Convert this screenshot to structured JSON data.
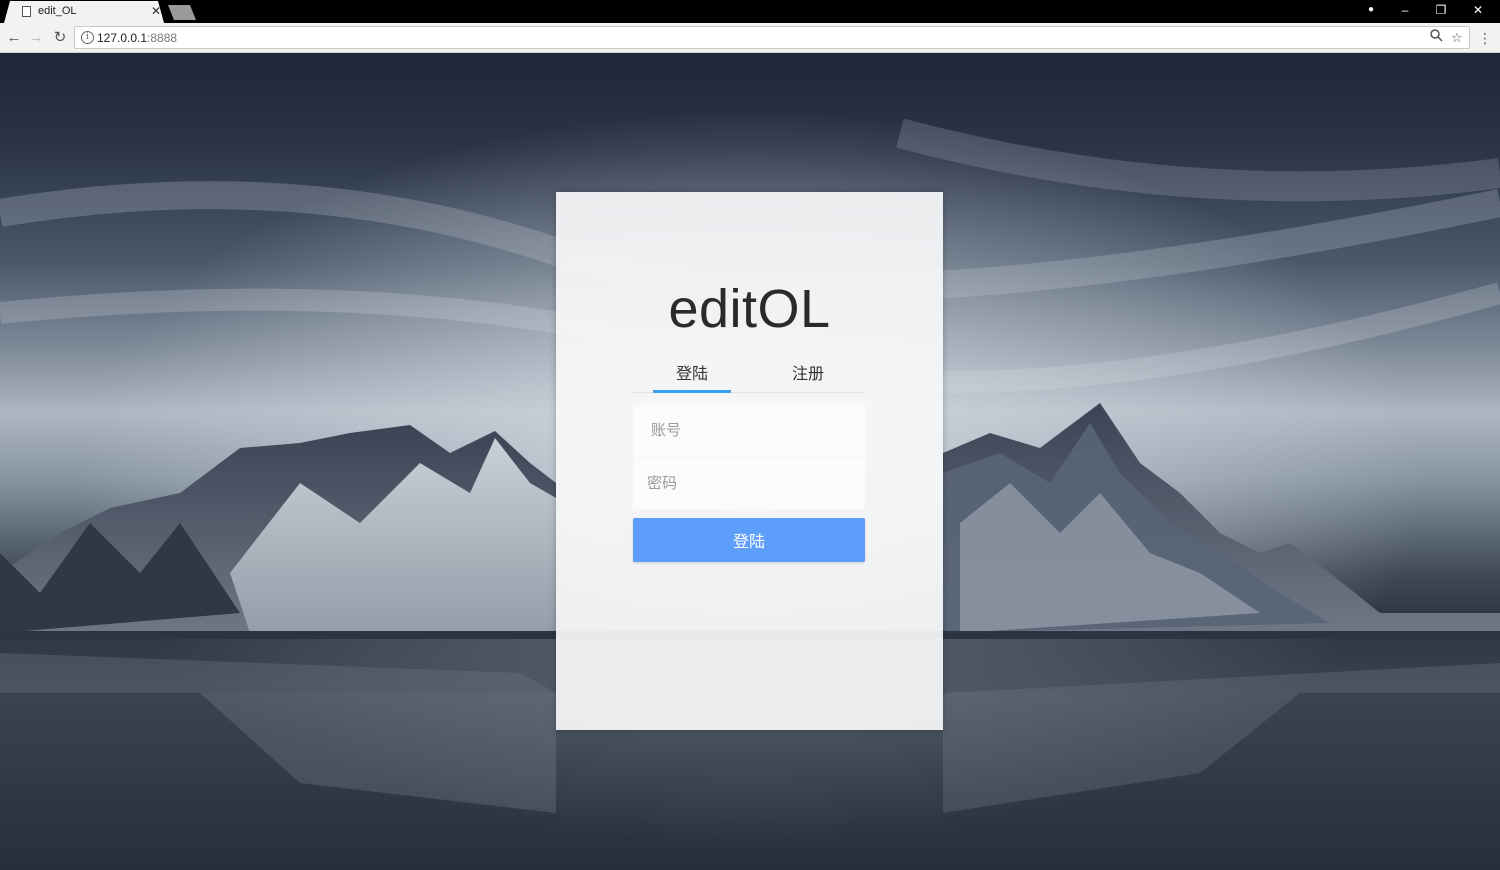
{
  "browser": {
    "tab_title": "edit_OL",
    "url_host": "127.0.0.1",
    "url_port": ":8888"
  },
  "page": {
    "brand": "editOL",
    "tabs": [
      {
        "label": "登陆",
        "active": true
      },
      {
        "label": "注册",
        "active": false
      }
    ],
    "account_placeholder": "账号",
    "password_placeholder": "密码",
    "submit_label": "登陆"
  },
  "icons": {
    "tab": "page-icon",
    "close": "close-icon",
    "back": "back-arrow-icon",
    "forward": "forward-arrow-icon",
    "reload": "reload-icon",
    "info": "info-icon",
    "zoom": "zoom-icon",
    "bookmark": "star-icon",
    "menu": "kebab-menu-icon"
  },
  "colors": {
    "accent": "#5e9efb",
    "tab_underline": "#3ba0f0"
  }
}
